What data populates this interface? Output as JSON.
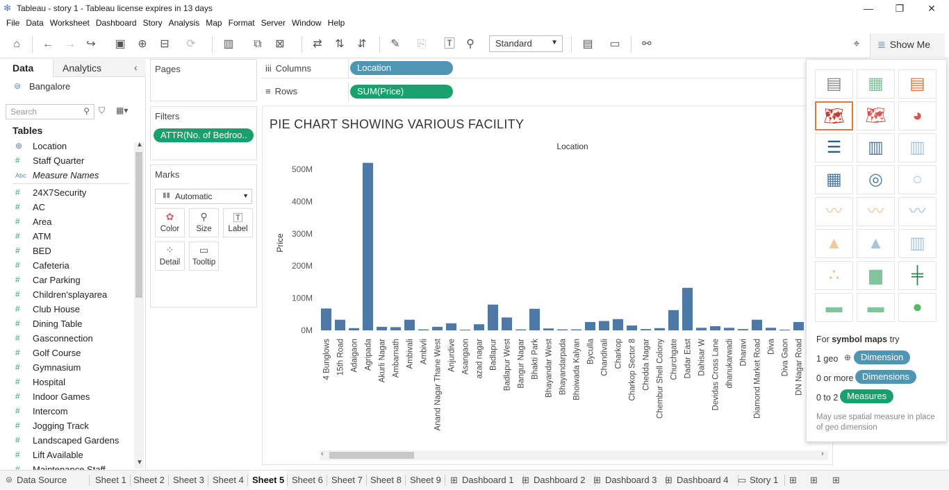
{
  "window": {
    "title": "Tableau - story 1 - Tableau license expires in 13 days",
    "min": "—",
    "max": "❐",
    "close": "✕"
  },
  "menu": [
    "File",
    "Data",
    "Worksheet",
    "Dashboard",
    "Story",
    "Analysis",
    "Map",
    "Format",
    "Server",
    "Window",
    "Help"
  ],
  "toolbar": {
    "standard": "Standard",
    "show_me": "Show Me"
  },
  "left": {
    "tab_data": "Data",
    "tab_analytics": "Analytics",
    "datasource": "Bangalore",
    "search_placeholder": "Search",
    "tables_heading": "Tables",
    "fields": [
      {
        "label": "Location",
        "type": "geo"
      },
      {
        "label": "Staff Quarter",
        "type": "num"
      },
      {
        "label": "Measure Names",
        "type": "abc"
      },
      {
        "label": "24X7Security",
        "type": "num"
      },
      {
        "label": "AC",
        "type": "num"
      },
      {
        "label": "Area",
        "type": "num"
      },
      {
        "label": "ATM",
        "type": "num"
      },
      {
        "label": "BED",
        "type": "num"
      },
      {
        "label": "Cafeteria",
        "type": "num"
      },
      {
        "label": "Car Parking",
        "type": "num"
      },
      {
        "label": "Children'splayarea",
        "type": "num"
      },
      {
        "label": "Club House",
        "type": "num"
      },
      {
        "label": "Dining Table",
        "type": "num"
      },
      {
        "label": "Gasconnection",
        "type": "num"
      },
      {
        "label": "Golf Course",
        "type": "num"
      },
      {
        "label": "Gymnasium",
        "type": "num"
      },
      {
        "label": "Hospital",
        "type": "num"
      },
      {
        "label": "Indoor Games",
        "type": "num"
      },
      {
        "label": "Intercom",
        "type": "num"
      },
      {
        "label": "Jogging Track",
        "type": "num"
      },
      {
        "label": "Landscaped Gardens",
        "type": "num"
      },
      {
        "label": "Lift Available",
        "type": "num"
      },
      {
        "label": "Maintenance Staff",
        "type": "num"
      }
    ]
  },
  "cards": {
    "pages": "Pages",
    "filters": "Filters",
    "filter_pill": "ATTR(No. of Bedroo..",
    "marks": "Marks",
    "mark_type": "Automatic",
    "mark_buttons": [
      "Color",
      "Size",
      "Label",
      "Detail",
      "Tooltip"
    ]
  },
  "shelves": {
    "columns_label": "Columns",
    "columns_pill": "Location",
    "rows_label": "Rows",
    "rows_pill": "SUM(Price)"
  },
  "viz": {
    "title": "PIE CHART SHOWING VARIOUS FACILITY"
  },
  "chart_data": {
    "type": "bar",
    "title": "PIE CHART SHOWING VARIOUS FACILITY",
    "xlabel": "Location",
    "ylabel": "Price",
    "ylim": [
      0,
      530000000
    ],
    "yticks": [
      "0M",
      "100M",
      "200M",
      "300M",
      "400M",
      "500M"
    ],
    "categories": [
      "4 Bunglows",
      "15th Road",
      "Adaigaon",
      "Agripada",
      "Akurli Nagar",
      "Ambarnath",
      "Ambivali",
      "Ambivli",
      "Anand Nagar Thane West",
      "Anjurdive",
      "Asangaon",
      "azad nagar",
      "Badlapur",
      "Badlapur West",
      "Bangur Nagar",
      "Bhakti Park",
      "Bhayandar West",
      "Bhayandarpada",
      "Bhoiwada Kalyan",
      "Byculla",
      "Chandivali",
      "Charkop",
      "Charkop Sector 8",
      "Chedda Nagar",
      "Chembur Shell Colony",
      "Churchgate",
      "Dadar East",
      "Dahisar W",
      "Devidas Cross Lane",
      "dhanukarwadi",
      "Dharavi",
      "Diamond Market Road",
      "Diva",
      "Diva Gaon",
      "DN Nagar Road"
    ],
    "values": [
      68000000,
      33000000,
      7000000,
      520000000,
      11000000,
      10000000,
      33000000,
      3000000,
      11000000,
      22000000,
      2000000,
      19000000,
      80000000,
      40000000,
      3000000,
      67000000,
      6000000,
      3000000,
      3000000,
      26000000,
      29000000,
      35000000,
      15000000,
      4000000,
      7000000,
      63000000,
      132000000,
      8000000,
      13000000,
      8000000,
      4000000,
      33000000,
      8000000,
      2000000,
      26000000
    ]
  },
  "showme": {
    "hint_prefix": "For ",
    "hint_bold": "symbol maps",
    "hint_suffix": " try",
    "req1_count": "1 geo",
    "req1_pill": "Dimension",
    "req2_count": "0 or more",
    "req2_pill": "Dimensions",
    "req3_count": "0 to 2",
    "req3_pill": "Measures",
    "note": "May use spatial measure in place of geo dimension"
  },
  "sheets": [
    "Data Source",
    "Sheet 1",
    "Sheet 2",
    "Sheet 3",
    "Sheet 4",
    "Sheet 5",
    "Sheet 6",
    "Sheet 7",
    "Sheet 8",
    "Sheet 9",
    "Dashboard 1",
    "Dashboard 2",
    "Dashboard 3",
    "Dashboard 4",
    "Story 1"
  ],
  "active_sheet": "Sheet 5"
}
